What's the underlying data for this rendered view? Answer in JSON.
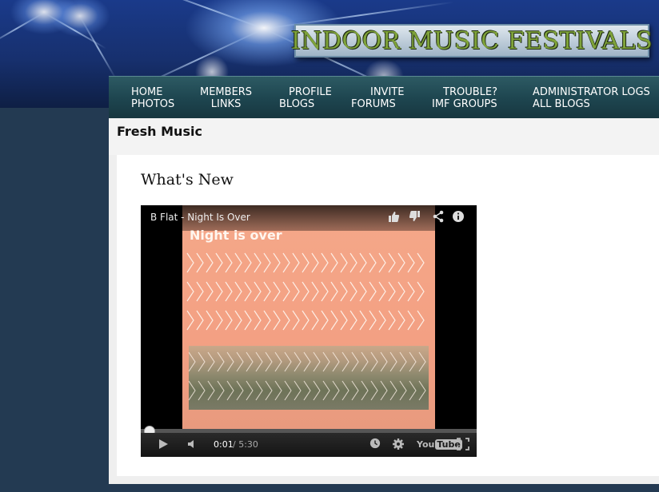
{
  "header": {
    "logo_text": "INDOOR MUSIC FESTIVALS"
  },
  "nav": {
    "row1": [
      "HOME",
      "MEMBERS",
      "PROFILE",
      "INVITE",
      "TROUBLE?",
      "ADMINISTRATOR LOGS"
    ],
    "row2": [
      "PHOTOS",
      "LINKS",
      "BLOGS",
      "FORUMS",
      "IMF GROUPS",
      "ALL BLOGS"
    ]
  },
  "section": {
    "title": "Fresh Music",
    "heading": "What's New"
  },
  "video": {
    "title": "B Flat - Night Is Over",
    "artwork_title": "Night is over",
    "time_current": "0:01",
    "time_total": "/ 5:30",
    "progress_fraction": 0.003,
    "youtube_label": "You",
    "youtube_label_box": "Tube"
  },
  "colors": {
    "page_background": "#243a52",
    "nav_background": "#1e4650",
    "logo_text": "#7fa33a"
  },
  "icons": {
    "like": "thumbs-up-icon",
    "dislike": "thumbs-down-icon",
    "share": "share-icon",
    "info": "info-icon",
    "play": "play-icon",
    "volume": "volume-icon",
    "watch_later": "clock-icon",
    "settings": "gear-icon",
    "fullscreen": "fullscreen-icon"
  }
}
